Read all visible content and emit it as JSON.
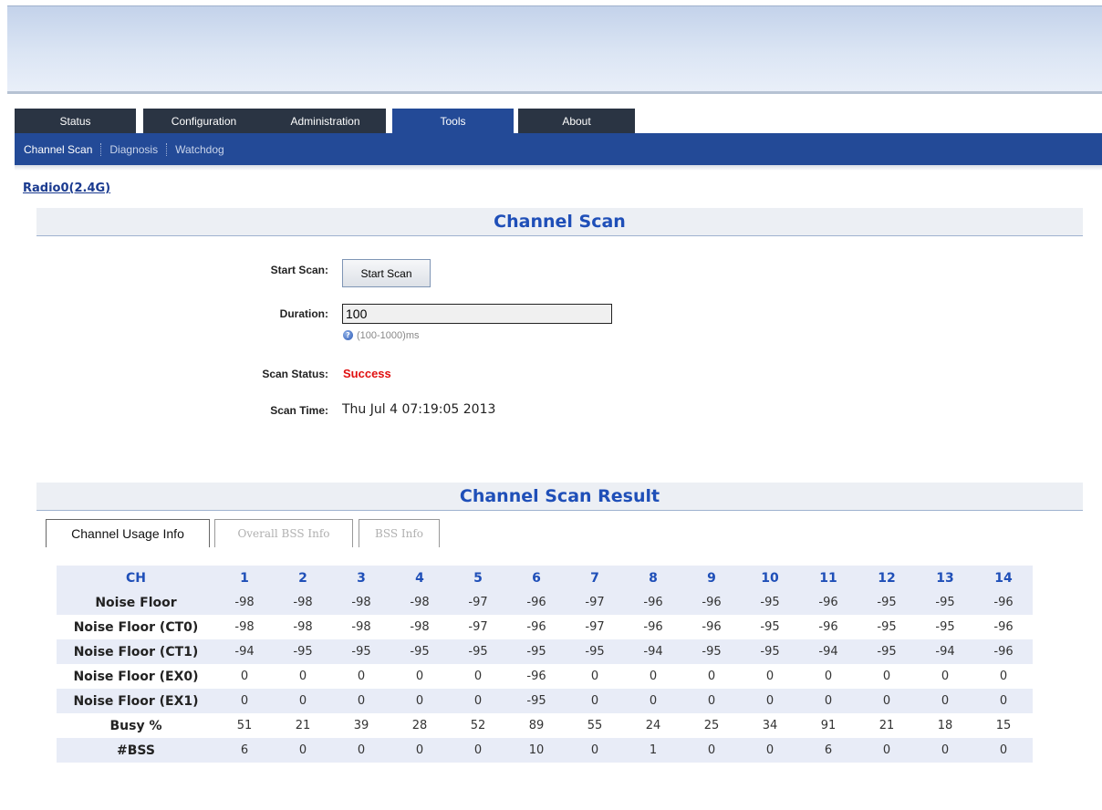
{
  "tabs": [
    {
      "label": "Status",
      "active": false
    },
    {
      "label": "Configuration",
      "active": false
    },
    {
      "label": "Administration",
      "active": false
    },
    {
      "label": "Tools",
      "active": true
    },
    {
      "label": "About",
      "active": false
    }
  ],
  "subnav": {
    "items": [
      {
        "label": "Channel Scan",
        "active": true
      },
      {
        "label": "Diagnosis",
        "active": false
      },
      {
        "label": "Watchdog",
        "active": false
      }
    ]
  },
  "radio_link": "Radio0(2.4G)",
  "channel_scan": {
    "title": "Channel Scan",
    "start_scan_label": "Start Scan:",
    "start_scan_button": "Start Scan",
    "duration_label": "Duration:",
    "duration_value": "100",
    "duration_hint": "(100-1000)ms",
    "scan_status_label": "Scan Status:",
    "scan_status_value": "Success",
    "scan_time_label": "Scan Time:",
    "scan_time_value": "Thu Jul 4 07:19:05 2013"
  },
  "result": {
    "title": "Channel Scan Result",
    "subtabs": [
      {
        "label": "Channel Usage Info",
        "active": true
      },
      {
        "label": "Overall BSS Info",
        "active": false
      },
      {
        "label": "BSS Info",
        "active": false
      }
    ],
    "table": {
      "header": [
        "CH",
        "1",
        "2",
        "3",
        "4",
        "5",
        "6",
        "7",
        "8",
        "9",
        "10",
        "11",
        "12",
        "13",
        "14"
      ],
      "rows": [
        {
          "label": "Noise Floor",
          "values": [
            "-98",
            "-98",
            "-98",
            "-98",
            "-97",
            "-96",
            "-97",
            "-96",
            "-96",
            "-95",
            "-96",
            "-95",
            "-95",
            "-96"
          ]
        },
        {
          "label": "Noise Floor (CT0)",
          "values": [
            "-98",
            "-98",
            "-98",
            "-98",
            "-97",
            "-96",
            "-97",
            "-96",
            "-96",
            "-95",
            "-96",
            "-95",
            "-95",
            "-96"
          ]
        },
        {
          "label": "Noise Floor (CT1)",
          "values": [
            "-94",
            "-95",
            "-95",
            "-95",
            "-95",
            "-95",
            "-95",
            "-94",
            "-95",
            "-95",
            "-94",
            "-95",
            "-94",
            "-96"
          ]
        },
        {
          "label": "Noise Floor (EX0)",
          "values": [
            "0",
            "0",
            "0",
            "0",
            "0",
            "-96",
            "0",
            "0",
            "0",
            "0",
            "0",
            "0",
            "0",
            "0"
          ]
        },
        {
          "label": "Noise Floor (EX1)",
          "values": [
            "0",
            "0",
            "0",
            "0",
            "0",
            "-95",
            "0",
            "0",
            "0",
            "0",
            "0",
            "0",
            "0",
            "0"
          ]
        },
        {
          "label": "Busy %",
          "values": [
            "51",
            "21",
            "39",
            "28",
            "52",
            "89",
            "55",
            "24",
            "25",
            "34",
            "91",
            "21",
            "18",
            "15"
          ]
        },
        {
          "label": "#BSS",
          "values": [
            "6",
            "0",
            "0",
            "0",
            "0",
            "10",
            "0",
            "1",
            "0",
            "0",
            "6",
            "0",
            "0",
            "0"
          ]
        }
      ]
    }
  },
  "colors": {
    "nav_dark": "#2a3443",
    "nav_active": "#234a97",
    "header_text": "#1f4fb8",
    "status_success": "#e01010",
    "row_shade": "#e8ecf7"
  }
}
